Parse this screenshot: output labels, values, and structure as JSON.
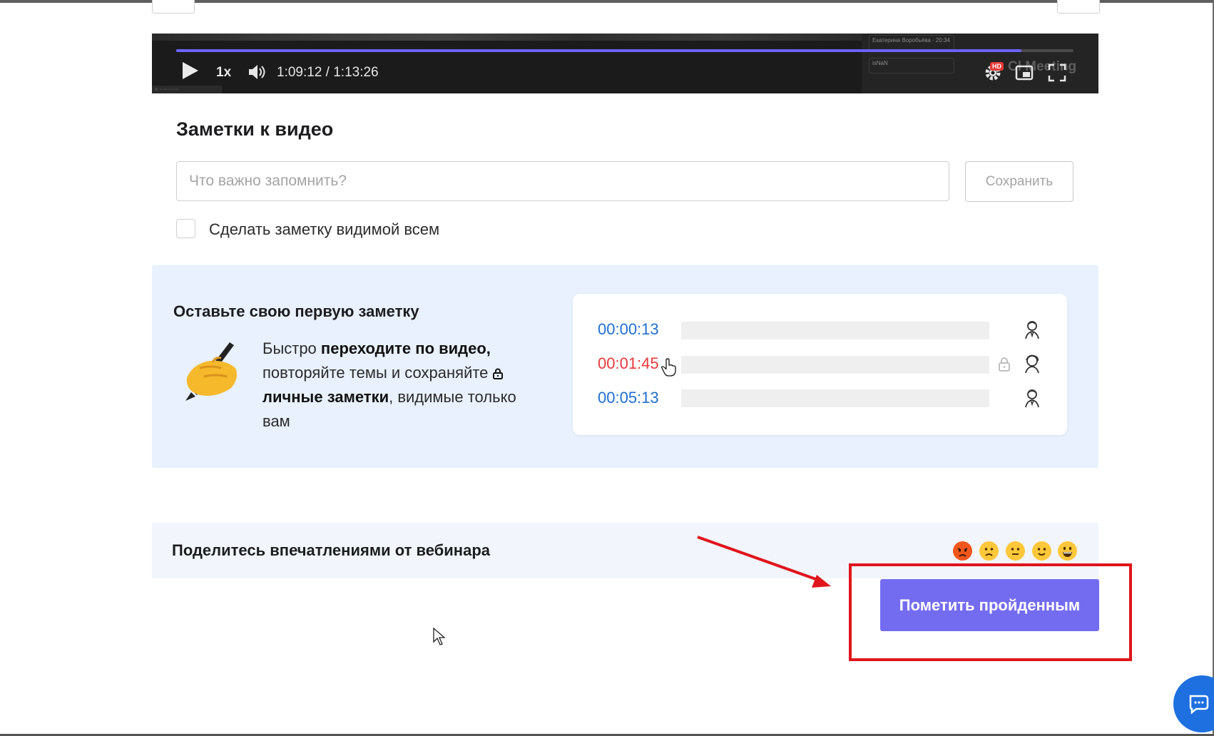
{
  "video": {
    "speed_label": "1x",
    "time_label": "1:09:12 / 1:13:26",
    "progress_fraction": 0.942,
    "hd_badge": "HD",
    "watermark": "Cl Meeting",
    "side_card_1": "Екатерина Воробьёва · 20:34",
    "side_card_2": "isNaN"
  },
  "notes": {
    "title": "Заметки к видео",
    "input_placeholder": "Что важно запомнить?",
    "save_label": "Сохранить",
    "visible_checkbox_label": "Сделать заметку видимой всем"
  },
  "promo": {
    "title": "Оставьте свою первую заметку",
    "text_1": "Быстро ",
    "text_bold_1": "переходите по видео,",
    "text_2": " повторяйте темы и сохраняйте ",
    "text_bold_2": "личные заметки",
    "text_3": ", видимые только вам",
    "examples": [
      {
        "time": "00:00:13",
        "color": "#1f6fd1",
        "private": false
      },
      {
        "time": "00:01:45",
        "color": "#e5393a",
        "private": true
      },
      {
        "time": "00:05:13",
        "color": "#1f6fd1",
        "private": false
      }
    ]
  },
  "feedback": {
    "title": "Поделитесь впечатлениями от вебинара",
    "emojis": [
      "angry-face-icon",
      "slightly-frowning-face-icon",
      "neutral-face-icon",
      "slightly-smiling-face-icon",
      "grinning-face-icon"
    ]
  },
  "complete": {
    "button_label": "Пометить пройденным"
  },
  "colors": {
    "accent": "#746cf0",
    "highlight_red": "#e0151c",
    "promo_bg": "#e8f1fd",
    "link_blue": "#1f6fd1"
  }
}
